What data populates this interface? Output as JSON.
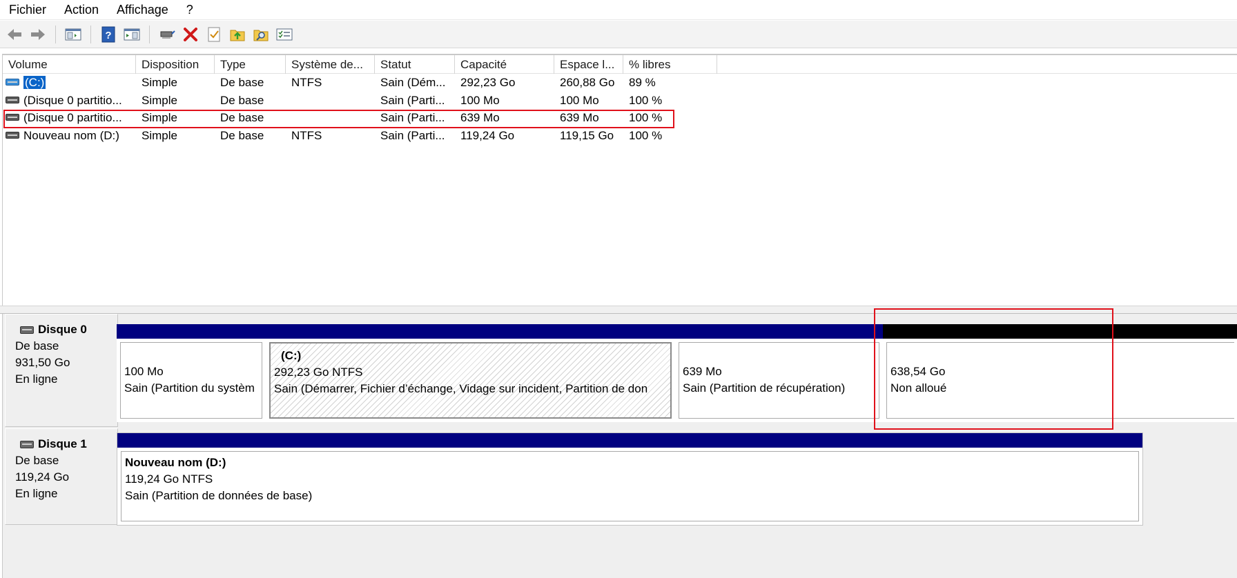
{
  "menu": [
    "Fichier",
    "Action",
    "Affichage",
    "?"
  ],
  "toolbar": {
    "buttons": [
      {
        "name": "back-arrow-icon"
      },
      {
        "name": "forward-arrow-icon"
      },
      {
        "name": "console-tree-icon"
      },
      {
        "name": "help-icon"
      },
      {
        "name": "show-pane-icon"
      },
      {
        "name": "connect-drive-icon"
      },
      {
        "name": "delete-icon"
      },
      {
        "name": "properties-icon"
      },
      {
        "name": "folder-up-icon"
      },
      {
        "name": "folder-search-icon"
      },
      {
        "name": "settings-list-icon"
      }
    ]
  },
  "table": {
    "headers": [
      "Volume",
      "Disposition",
      "Type",
      "Système de...",
      "Statut",
      "Capacité",
      "Espace l...",
      "% libres"
    ],
    "rows": [
      {
        "volume": "(C:)",
        "icon": "system-drive-icon",
        "disposition": "Simple",
        "type": "De base",
        "fs": "NTFS",
        "statut": "Sain (Dém...",
        "capacite": "292,23 Go",
        "espace": "260,88 Go",
        "libres": "89 %"
      },
      {
        "volume": "(Disque 0 partitio...",
        "icon": "drive-icon",
        "disposition": "Simple",
        "type": "De base",
        "fs": "",
        "statut": "Sain (Parti...",
        "capacite": "100 Mo",
        "espace": "100 Mo",
        "libres": "100 %"
      },
      {
        "volume": "(Disque 0 partitio...",
        "icon": "drive-icon",
        "disposition": "Simple",
        "type": "De base",
        "fs": "",
        "statut": "Sain (Parti...",
        "capacite": "639 Mo",
        "espace": "639 Mo",
        "libres": "100 %"
      },
      {
        "volume": "Nouveau nom (D:)",
        "icon": "drive-icon",
        "disposition": "Simple",
        "type": "De base",
        "fs": "NTFS",
        "statut": "Sain (Parti...",
        "capacite": "119,24 Go",
        "espace": "119,15 Go",
        "libres": "100 %"
      }
    ]
  },
  "disks": [
    {
      "name": "Disque 0",
      "type": "De base",
      "size": "931,50 Go",
      "status": "En ligne",
      "partitions": [
        {
          "title": "",
          "line1": "100 Mo",
          "line2": "Sain (Partition du systèm"
        },
        {
          "title": "(C:)",
          "line1": "292,23 Go NTFS",
          "line2": "Sain (Démarrer, Fichier d’échange, Vidage sur incident, Partition de don"
        },
        {
          "title": "",
          "line1": "639 Mo",
          "line2": "Sain (Partition de récupération)"
        },
        {
          "title": "",
          "line1": "638,54 Go",
          "line2": "Non alloué"
        }
      ]
    },
    {
      "name": "Disque 1",
      "type": "De base",
      "size": "119,24 Go",
      "status": "En ligne",
      "partitions": [
        {
          "title": "Nouveau nom  (D:)",
          "line1": "119,24 Go NTFS",
          "line2": "Sain (Partition de données de base)"
        }
      ]
    }
  ],
  "colors": {
    "primary_partition_band": "#000080",
    "unallocated_band": "#000000",
    "annotation_red": "#e0101a",
    "selection_blue": "#0a64c8"
  }
}
